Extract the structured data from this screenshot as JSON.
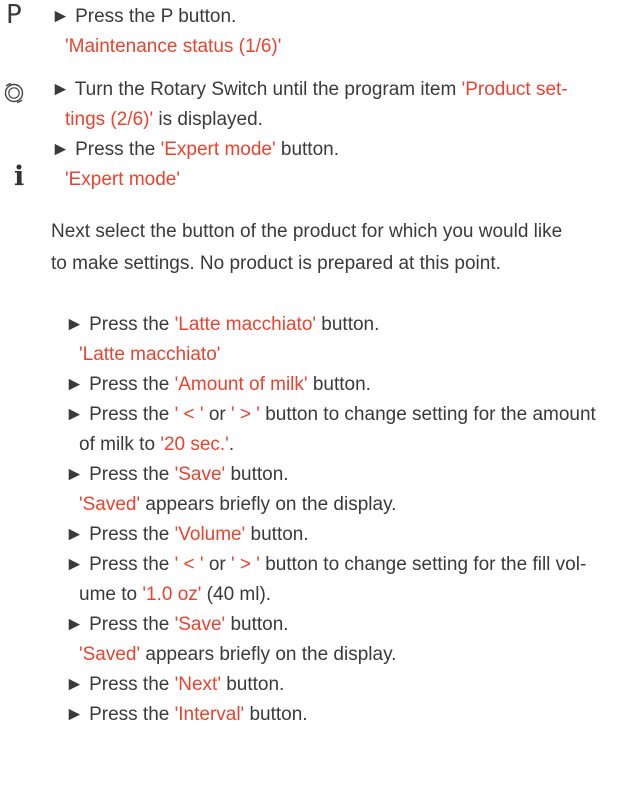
{
  "icons": {
    "p_label": "P",
    "rotary": "rotary-switch-icon",
    "info_glyph": "i"
  },
  "section1": {
    "s1": "► Press the P button.",
    "s2": "'Maintenance status (1/6)'"
  },
  "section2": {
    "l1a": "► Turn the Rotary Switch until the program item ",
    "l1b": "'Product set-",
    "l2a": "tings (2/6)'",
    "l2b": " is displayed.",
    "l3a": "► Press the ",
    "l3b": "'Expert mode'",
    "l3c": " button.",
    "l4": "'Expert mode'"
  },
  "info": {
    "l1": "Next select the button of the product for which you would like",
    "l2": "to make settings. No product is prepared at this point."
  },
  "steps": {
    "a1": "► Press the ",
    "a2": "'Latte macchiato'",
    "a3": " button.",
    "b1": "'Latte macchiato'",
    "c1": "► Press the ",
    "c2": "'Amount of milk'",
    "c3": " button.",
    "d1": "► Press the ",
    "d2": "' < '",
    "d3": " or ",
    "d4": "' > '",
    "d5": " button to change setting for the amount",
    "e1": "of milk to ",
    "e2": "'20 sec.'",
    "e3": ".",
    "f1": "► Press the ",
    "f2": "'Save'",
    "f3": " button.",
    "g1": "'Saved'",
    "g2": " appears briefly on the display.",
    "h1": "► Press the ",
    "h2": "'Volume'",
    "h3": " button.",
    "i1": "► Press the ",
    "i2": "' < '",
    "i3": " or ",
    "i4": "' > '",
    "i5": " button to change setting for the fill vol-",
    "j1": "ume to ",
    "j2": "'1.0 oz'",
    "j3": " (40 ml).",
    "k1": "► Press the ",
    "k2": "'Save'",
    "k3": " button.",
    "l1": "'Saved'",
    "l2": " appears briefly on the display.",
    "m1": "► Press the ",
    "m2": "'Next'",
    "m3": " button.",
    "n1": "► Press the ",
    "n2": "'Interval'",
    "n3": " button."
  },
  "colors": {
    "text": "#3a3a3a",
    "highlight": "#e8432f"
  }
}
